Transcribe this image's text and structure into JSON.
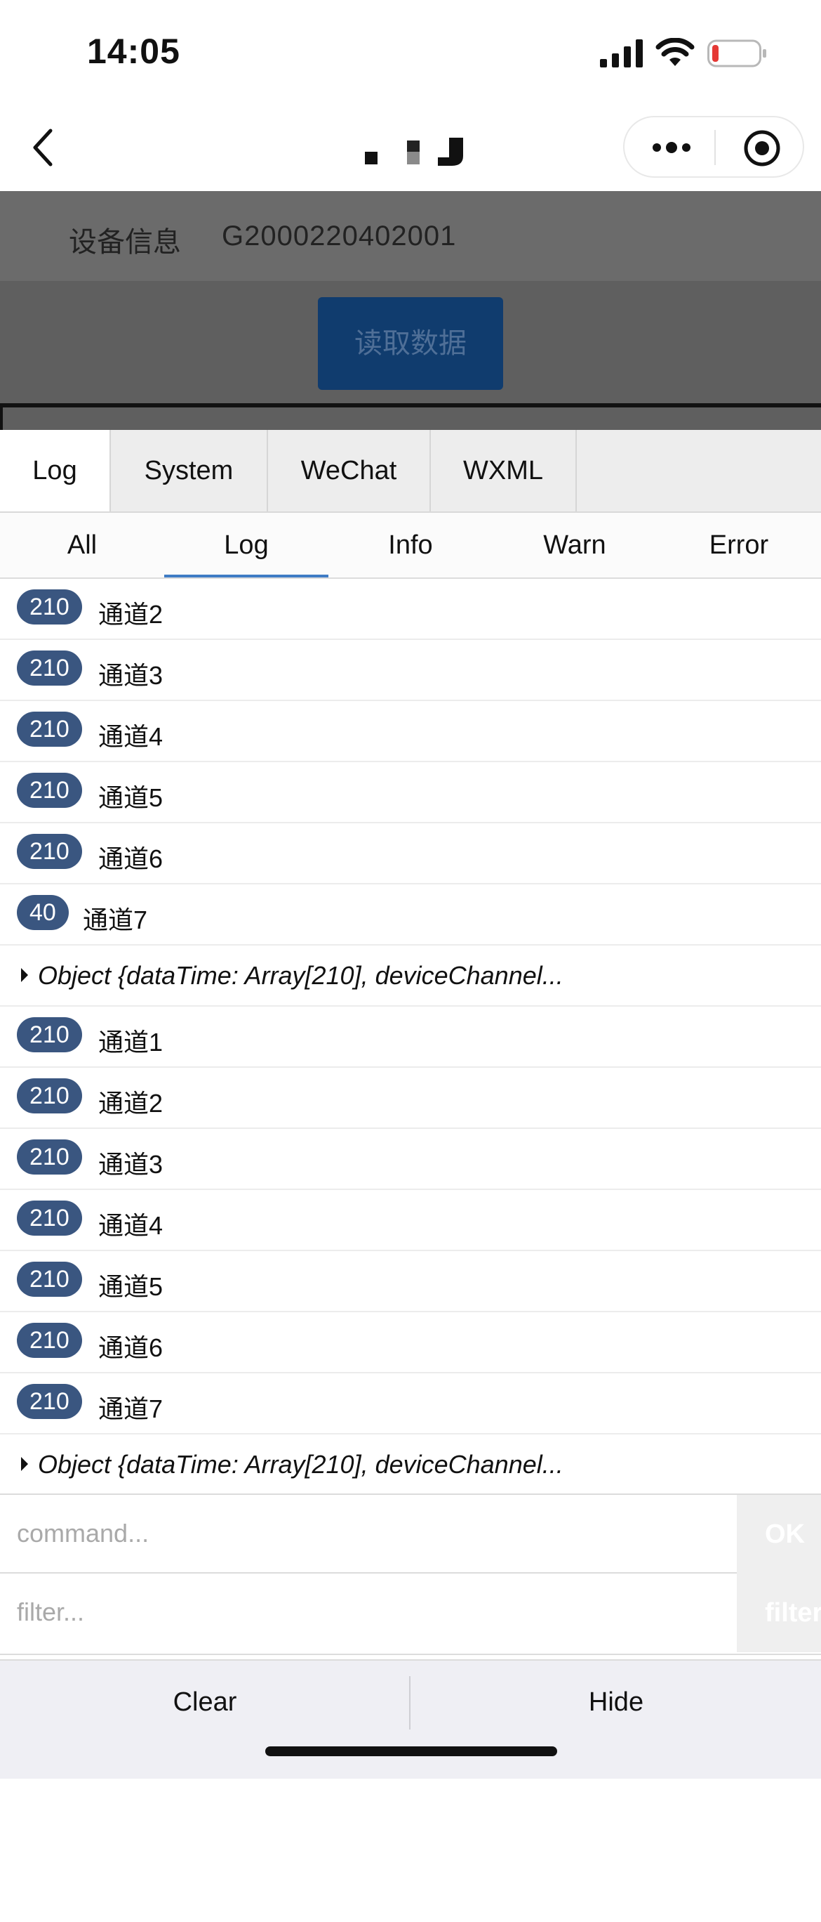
{
  "status_bar": {
    "time": "14:05",
    "icons": [
      "signal-icon",
      "wifi-icon",
      "battery-icon"
    ],
    "battery_color": "#e53935"
  },
  "nav_bar": {
    "icons": [
      "back-icon",
      "more-icon",
      "target-icon"
    ]
  },
  "page": {
    "device_label": "设备信息",
    "device_value": "G2000220402001",
    "read_button": "读取数据",
    "button_color": "#103c6e"
  },
  "console": {
    "top_tabs": [
      {
        "label": "Log",
        "active": true
      },
      {
        "label": "System",
        "active": false
      },
      {
        "label": "WeChat",
        "active": false
      },
      {
        "label": "WXML",
        "active": false
      }
    ],
    "sub_tabs": [
      {
        "label": "All",
        "active": false
      },
      {
        "label": "Log",
        "active": true
      },
      {
        "label": "Info",
        "active": false
      },
      {
        "label": "Warn",
        "active": false
      },
      {
        "label": "Error",
        "active": false
      }
    ],
    "badge_color": "#3a5680",
    "active_color": "#3f7cc5",
    "logs": [
      {
        "repeat": "210",
        "text": "通道2"
      },
      {
        "repeat": "210",
        "text": "通道3"
      },
      {
        "repeat": "210",
        "text": "通道4"
      },
      {
        "repeat": "210",
        "text": "通道5"
      },
      {
        "repeat": "210",
        "text": "通道6"
      },
      {
        "repeat": "40",
        "text": "通道7"
      },
      {
        "object": true,
        "text": "Object {dataTime: Array[210], deviceChannel..."
      },
      {
        "repeat": "210",
        "text": "通道1"
      },
      {
        "repeat": "210",
        "text": "通道2"
      },
      {
        "repeat": "210",
        "text": "通道3"
      },
      {
        "repeat": "210",
        "text": "通道4"
      },
      {
        "repeat": "210",
        "text": "通道5"
      },
      {
        "repeat": "210",
        "text": "通道6"
      },
      {
        "repeat": "210",
        "text": "通道7"
      },
      {
        "object": true,
        "text": "Object {dataTime: Array[210], deviceChannel..."
      }
    ],
    "command_placeholder": "command...",
    "command_button": "OK",
    "filter_placeholder": "filter...",
    "filter_button": "filter",
    "footer": {
      "clear": "Clear",
      "hide": "Hide"
    }
  }
}
